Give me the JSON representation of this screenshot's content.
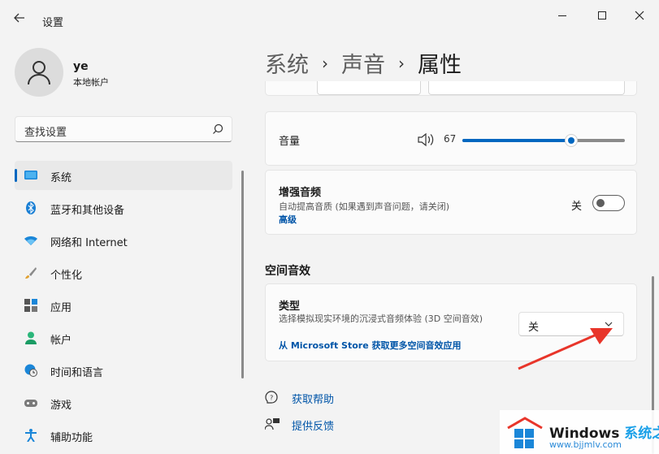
{
  "window": {
    "title": "设置",
    "back_icon": "back-arrow-icon",
    "minimize_icon": "minimize-icon",
    "maximize_icon": "maximize-icon",
    "close_icon": "close-icon"
  },
  "user": {
    "name": "ye",
    "account_type": "本地帐户",
    "avatar_icon": "person-icon"
  },
  "search": {
    "placeholder": "查找设置",
    "icon": "search-icon"
  },
  "sidebar": {
    "items": [
      {
        "label": "系统",
        "icon": "system-icon",
        "active": true
      },
      {
        "label": "蓝牙和其他设备",
        "icon": "bluetooth-icon",
        "active": false
      },
      {
        "label": "网络和 Internet",
        "icon": "wifi-icon",
        "active": false
      },
      {
        "label": "个性化",
        "icon": "brush-icon",
        "active": false
      },
      {
        "label": "应用",
        "icon": "apps-icon",
        "active": false
      },
      {
        "label": "帐户",
        "icon": "account-icon",
        "active": false
      },
      {
        "label": "时间和语言",
        "icon": "globe-clock-icon",
        "active": false
      },
      {
        "label": "游戏",
        "icon": "gamepad-icon",
        "active": false
      },
      {
        "label": "辅助功能",
        "icon": "accessibility-icon",
        "active": false
      }
    ]
  },
  "breadcrumb": {
    "items": [
      "系统",
      "声音",
      "属性"
    ],
    "separator": "›"
  },
  "volume": {
    "label": "音量",
    "value": "67",
    "level": 0.67,
    "icon": "speaker-icon"
  },
  "enhance_audio": {
    "title": "增强音频",
    "description": "自动提高音质 (如果遇到声音问题，请关闭)",
    "link": "高级",
    "toggle_label": "关",
    "toggle_on": false
  },
  "spatial_sound": {
    "section_title": "空间音效",
    "type_title": "类型",
    "type_description": "选择模拟现实环境的沉浸式音频体验 (3D 空间音效)",
    "store_link": "从 Microsoft Store 获取更多空间音效应用",
    "selected_value": "关",
    "dropdown_icon": "chevron-down-icon"
  },
  "help": {
    "get_help": "获取帮助",
    "feedback": "提供反馈"
  },
  "watermark": {
    "brand": "Windows",
    "brand_suffix": "系统之家",
    "url": "www.bjjmlv.com"
  },
  "colors": {
    "accent": "#0067c0",
    "link": "#0055a8",
    "annotation_arrow": "#e8352a"
  }
}
